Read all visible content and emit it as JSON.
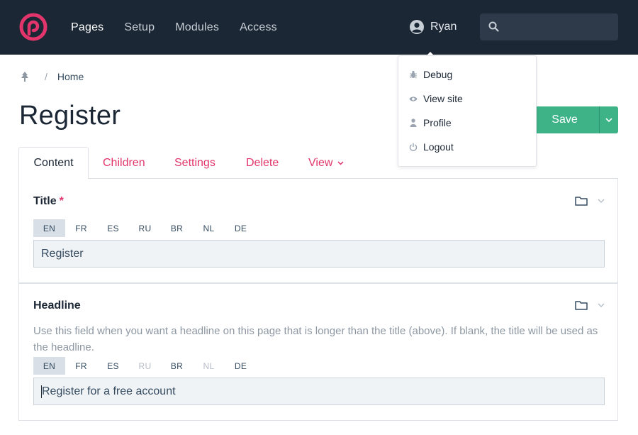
{
  "nav": {
    "items": [
      "Pages",
      "Setup",
      "Modules",
      "Access"
    ]
  },
  "user": {
    "name": "Ryan"
  },
  "search": {
    "placeholder": ""
  },
  "breadcrumb": {
    "sep": "/",
    "home": "Home"
  },
  "page": {
    "title": "Register"
  },
  "toolbar": {
    "save_label": "Save"
  },
  "tabs": [
    "Content",
    "Children",
    "Settings",
    "Delete",
    "View"
  ],
  "fields": {
    "title": {
      "label": "Title",
      "required_mark": "*",
      "languages": [
        "EN",
        "FR",
        "ES",
        "RU",
        "BR",
        "NL",
        "DE"
      ],
      "value": "Register"
    },
    "headline": {
      "label": "Headline",
      "help": "Use this field when you want a headline on this page that is longer than the title (above). If blank, the title will be used as the headline.",
      "languages": [
        "EN",
        "FR",
        "ES",
        "RU",
        "BR",
        "NL",
        "DE"
      ],
      "value": "Register for a free account"
    }
  },
  "user_menu": {
    "items": [
      "Debug",
      "View site",
      "Profile",
      "Logout"
    ]
  },
  "colors": {
    "accent": "#e2356c",
    "save": "#3eb388",
    "topbar": "#1c2735"
  }
}
